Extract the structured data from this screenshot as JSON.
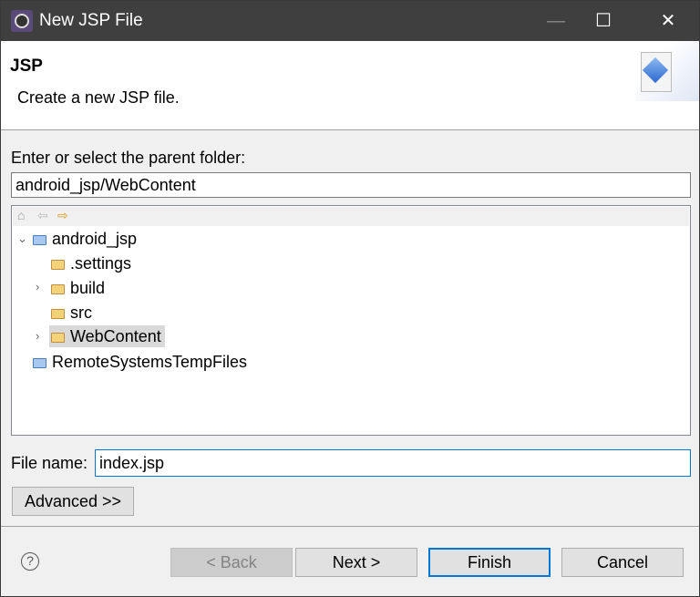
{
  "window": {
    "title": "New JSP File",
    "minimize_icon": "minimize-icon",
    "maximize_icon": "maximize-icon",
    "close_icon": "close-icon"
  },
  "header": {
    "title": "JSP",
    "description": "Create a new JSP file.",
    "icon": "jsp-file-icon"
  },
  "parent_folder": {
    "label": "Enter or select the parent folder:",
    "value": "android_jsp/WebContent"
  },
  "tree": {
    "toolbar": [
      "home-icon",
      "back-arrow-icon",
      "forward-arrow-icon"
    ],
    "items": [
      {
        "label": "android_jsp",
        "expanded": true
      },
      {
        "label": ".settings"
      },
      {
        "label": "build",
        "collapsed": true
      },
      {
        "label": "src"
      },
      {
        "label": "WebContent",
        "collapsed": true,
        "selected": true
      },
      {
        "label": "RemoteSystemsTempFiles"
      }
    ]
  },
  "file_name": {
    "label": "File name:",
    "value": "index.jsp"
  },
  "advanced_label": "Advanced >>",
  "buttons": {
    "back": "< Back",
    "next": "Next >",
    "finish": "Finish",
    "cancel": "Cancel"
  },
  "help_glyph": "?",
  "colors": {
    "titlebar": "#3f3f3f",
    "focus": "#0078d7",
    "selection": "#d9d9d9"
  }
}
